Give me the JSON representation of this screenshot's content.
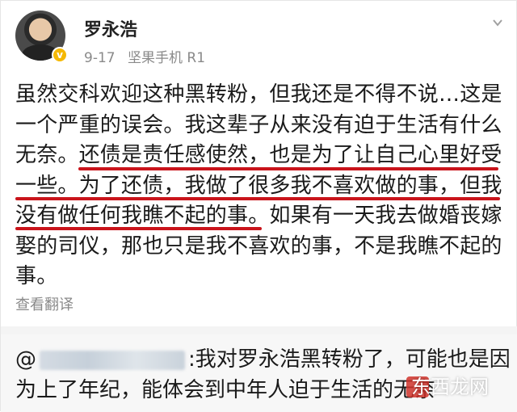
{
  "post": {
    "author": "罗永浩",
    "date": "9-17",
    "device": "坚果手机 R1",
    "lines": [
      "虽然交科欢迎这种黑转粉，但我还是不得不说…这是",
      "一个严重的误会。我这辈子从来没有迫于生活有什么",
      "无奈。还债是责任感使然，也是为了让自己心里好受",
      "一些。为了还债，我做了很多我不喜欢做的事，但我",
      "没有做任何我瞧不起的事。如果有一天我去做婚丧嫁",
      "娶的司仪，那也只是我不喜欢的事，不是我瞧不起的",
      "事。"
    ],
    "translate_label": "查看翻译"
  },
  "retweet": {
    "at": "@",
    "line1": ":我对罗永浩黑转粉了，可能也是因",
    "line2": "为上了年纪，能体会到中年人迫于生活的无奈"
  },
  "watermark": "东西龙网",
  "colors": {
    "underline": "#c9141b",
    "verified": "#f5b800"
  }
}
